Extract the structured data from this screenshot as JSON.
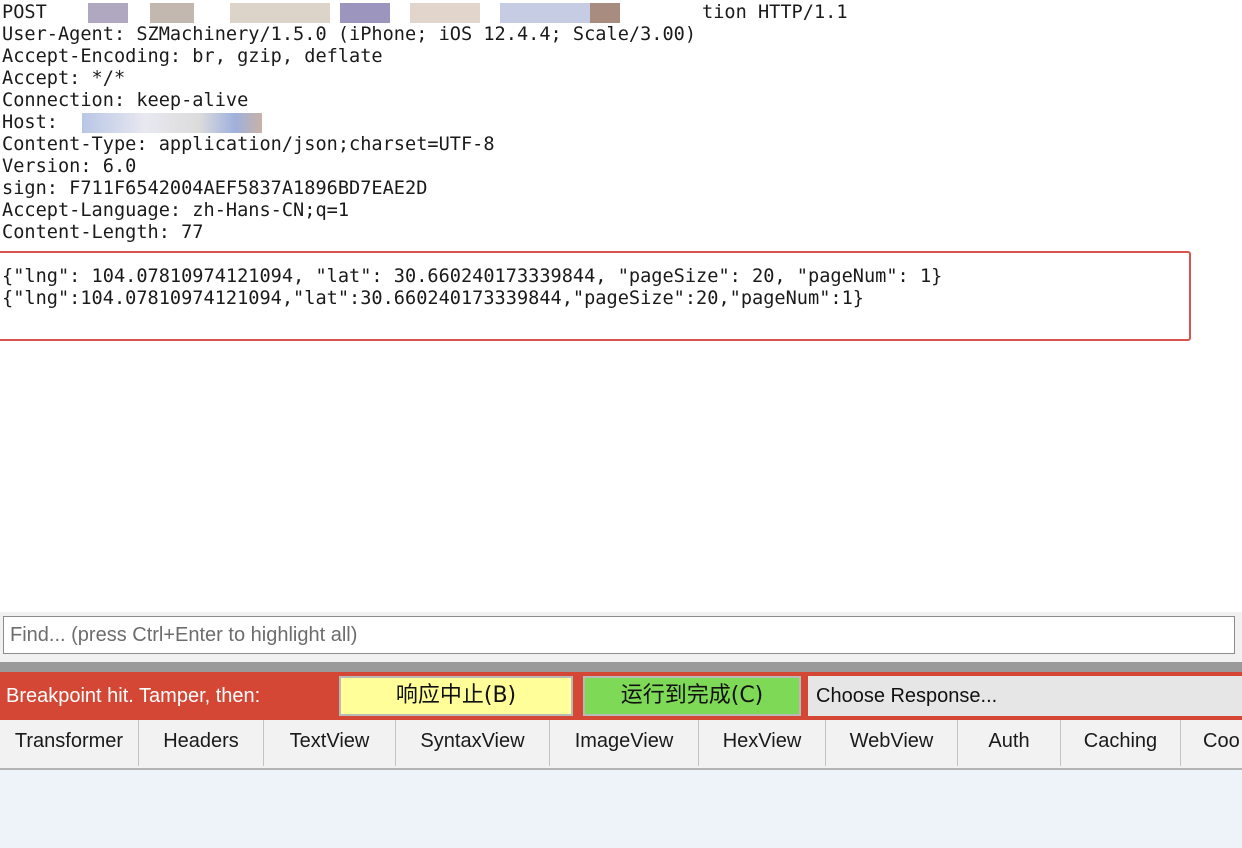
{
  "request": {
    "lines": [
      "POST",
      "User-Agent: SZMachinery/1.5.0 (iPhone; iOS 12.4.4; Scale/3.00)",
      "Accept-Encoding: br, gzip, deflate",
      "Accept: */*",
      "Connection: keep-alive",
      "Host:",
      "Content-Type: application/json;charset=UTF-8",
      "Version: 6.0",
      "sign: F711F6542004AEF5837A1896BD7EAE2D",
      "Accept-Language: zh-Hans-CN;q=1",
      "Content-Length: 77"
    ],
    "request_line_suffix": "tion HTTP/1.1",
    "body_lines": [
      "{\"lng\": 104.07810974121094, \"lat\": 30.660240173339844, \"pageSize\": 20, \"pageNum\": 1}",
      "{\"lng\":104.07810974121094,\"lat\":30.660240173339844,\"pageSize\":20,\"pageNum\":1}"
    ]
  },
  "find": {
    "placeholder": "Find... (press Ctrl+Enter to highlight all)"
  },
  "breakpoint": {
    "label": "Breakpoint hit. Tamper, then:",
    "abort_label": "响应中止(B)",
    "run_label": "运行到完成(C)",
    "choose_label": "Choose Response..."
  },
  "tabs": [
    "Transformer",
    "Headers",
    "TextView",
    "SyntaxView",
    "ImageView",
    "HexView",
    "WebView",
    "Auth",
    "Caching",
    "Coo"
  ],
  "colors": {
    "breakpoint_bar": "#d54735",
    "abort_button": "#fffe99",
    "run_button": "#7ed957",
    "highlight_box": "#d9534f"
  }
}
